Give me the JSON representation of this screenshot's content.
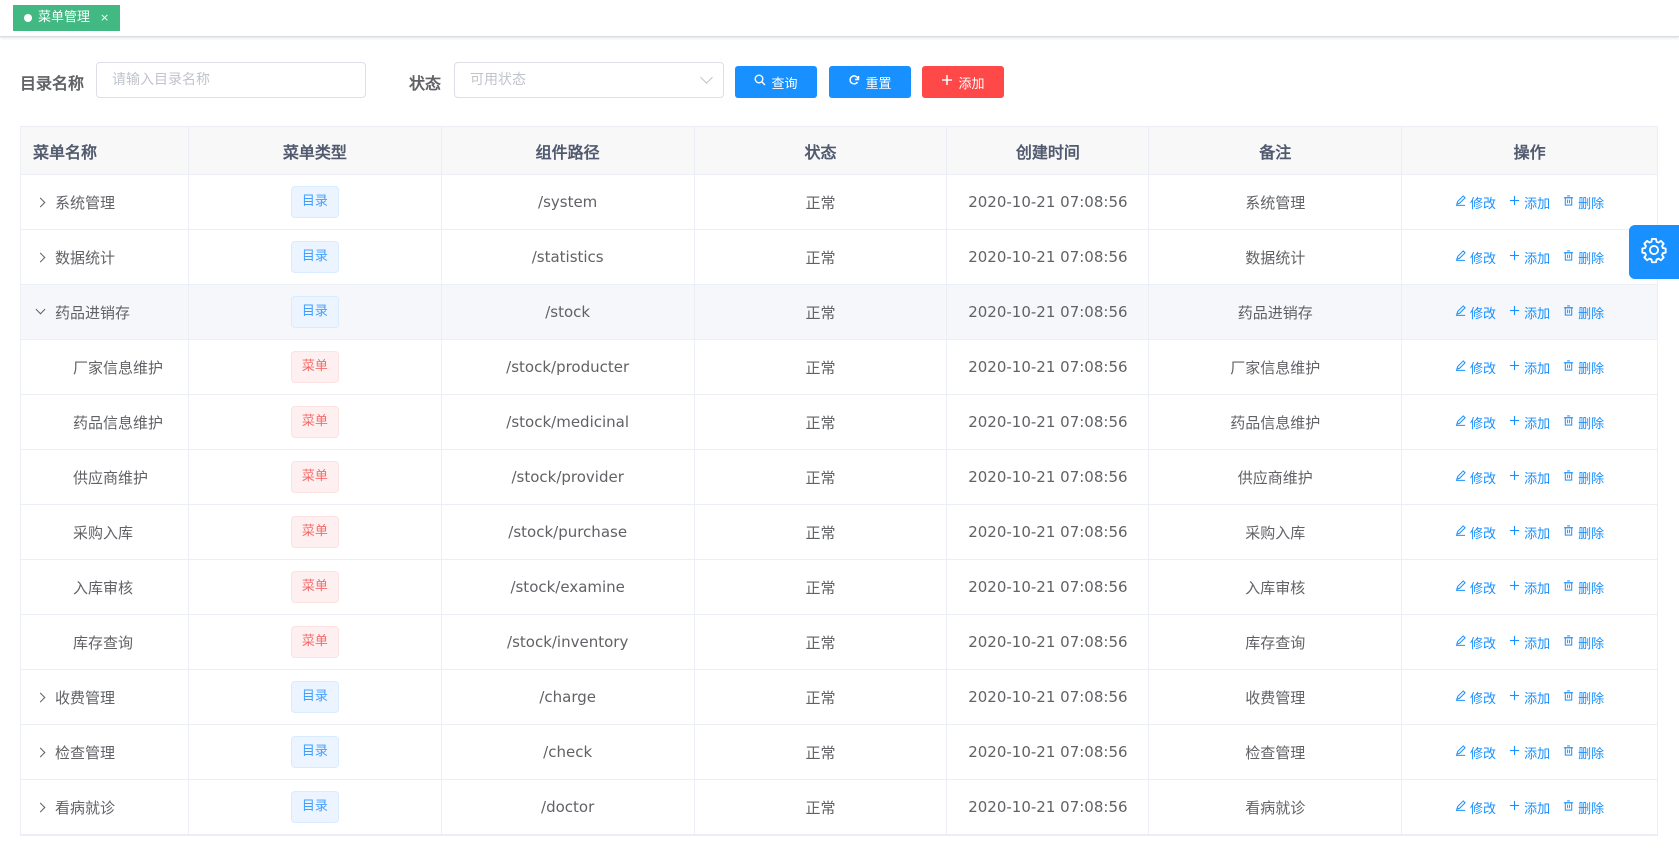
{
  "tab": {
    "label": "菜单管理",
    "close": "×"
  },
  "form": {
    "name_label": "目录名称",
    "name_placeholder": "请输入目录名称",
    "status_label": "状态",
    "status_placeholder": "可用状态",
    "query_label": "查询",
    "reset_label": "重置",
    "add_label": "添加"
  },
  "table": {
    "headers": [
      "菜单名称",
      "菜单类型",
      "组件路径",
      "状态",
      "创建时间",
      "备注",
      "操作"
    ],
    "actions": {
      "edit": "修改",
      "add": "添加",
      "delete": "删除"
    },
    "rows": [
      {
        "name": "系统管理",
        "type": "目录",
        "path": "/system",
        "status": "正常",
        "created": "2020-10-21 07:08:56",
        "remark": "系统管理"
      },
      {
        "name": "数据统计",
        "type": "目录",
        "path": "/statistics",
        "status": "正常",
        "created": "2020-10-21 07:08:56",
        "remark": "数据统计"
      },
      {
        "name": "药品进销存",
        "type": "目录",
        "path": "/stock",
        "status": "正常",
        "created": "2020-10-21 07:08:56",
        "remark": "药品进销存"
      },
      {
        "name": "厂家信息维护",
        "type": "菜单",
        "path": "/stock/producter",
        "status": "正常",
        "created": "2020-10-21 07:08:56",
        "remark": "厂家信息维护"
      },
      {
        "name": "药品信息维护",
        "type": "菜单",
        "path": "/stock/medicinal",
        "status": "正常",
        "created": "2020-10-21 07:08:56",
        "remark": "药品信息维护"
      },
      {
        "name": "供应商维护",
        "type": "菜单",
        "path": "/stock/provider",
        "status": "正常",
        "created": "2020-10-21 07:08:56",
        "remark": "供应商维护"
      },
      {
        "name": "采购入库",
        "type": "菜单",
        "path": "/stock/purchase",
        "status": "正常",
        "created": "2020-10-21 07:08:56",
        "remark": "采购入库"
      },
      {
        "name": "入库审核",
        "type": "菜单",
        "path": "/stock/examine",
        "status": "正常",
        "created": "2020-10-21 07:08:56",
        "remark": "入库审核"
      },
      {
        "name": "库存查询",
        "type": "菜单",
        "path": "/stock/inventory",
        "status": "正常",
        "created": "2020-10-21 07:08:56",
        "remark": "库存查询"
      },
      {
        "name": "收费管理",
        "type": "目录",
        "path": "/charge",
        "status": "正常",
        "created": "2020-10-21 07:08:56",
        "remark": "收费管理"
      },
      {
        "name": "检查管理",
        "type": "目录",
        "path": "/check",
        "status": "正常",
        "created": "2020-10-21 07:08:56",
        "remark": "检查管理"
      },
      {
        "name": "看病就诊",
        "type": "目录",
        "path": "/doctor",
        "status": "正常",
        "created": "2020-10-21 07:08:56",
        "remark": "看病就诊"
      }
    ]
  },
  "colors": {
    "primary": "#1890ff",
    "danger": "#ff4949",
    "tab": "#42b983"
  },
  "icons": {
    "settings": "gear-icon"
  }
}
